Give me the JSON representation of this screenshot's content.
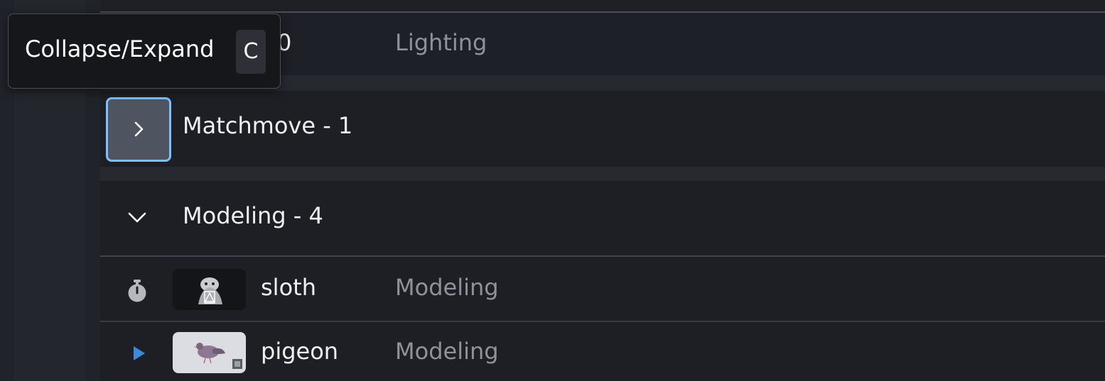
{
  "tooltip": {
    "label": "Collapse/Expand",
    "shortcut": "C"
  },
  "rows": {
    "lighting": {
      "name_partial": "n020",
      "task_type": "Lighting"
    },
    "sloth": {
      "name": "sloth",
      "task_type": "Modeling",
      "thumbnail": "sloth-thumbnail"
    },
    "pigeon": {
      "name": "pigeon",
      "task_type": "Modeling",
      "thumbnail": "pigeon-thumbnail"
    }
  },
  "groups": {
    "matchmove": {
      "label": "Matchmove - 1",
      "state": "collapsed"
    },
    "modeling": {
      "label": "Modeling - 4",
      "state": "expanded"
    }
  },
  "icons": {
    "expand": "chevron-right-icon",
    "collapse": "chevron-down-icon",
    "sloth_status": "timer-icon",
    "pigeon_status": "play-icon"
  },
  "colors": {
    "focus_ring": "#7cc0ff",
    "play_icon": "#3d8bd8",
    "background": "#1c1e24"
  }
}
